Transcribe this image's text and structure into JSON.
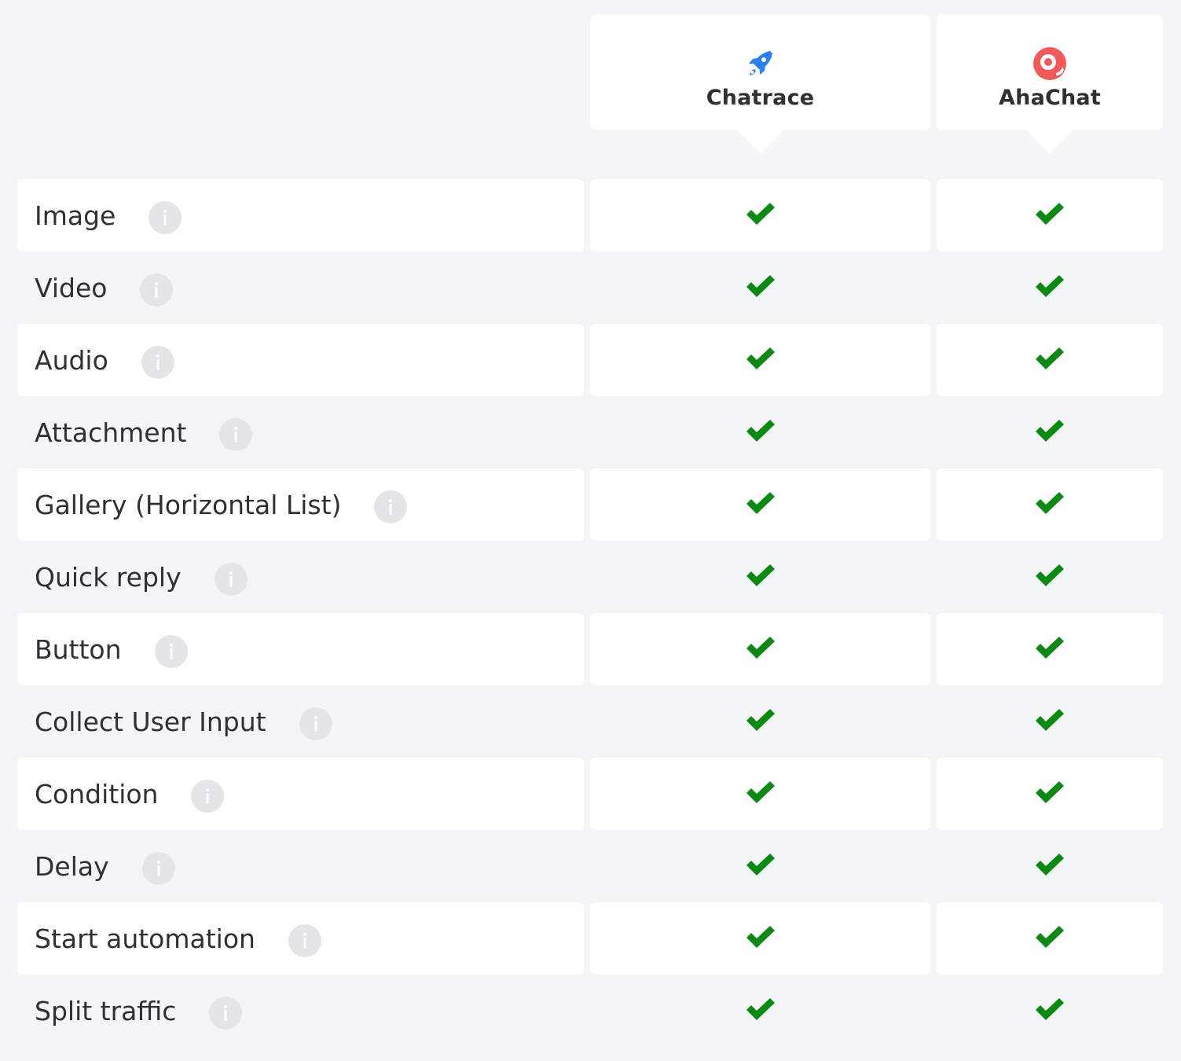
{
  "columns": {
    "chatrace": {
      "name": "Chatrace",
      "logo_icon": "rocket-icon",
      "logo_color": "#2b7ff6"
    },
    "ahachat": {
      "name": "AhaChat",
      "logo_icon": "ahachat-logo-icon",
      "logo_color": "#f25a5a"
    }
  },
  "colors": {
    "background": "#f4f5f7",
    "card": "#ffffff",
    "check": "#0a8a13",
    "info_badge": "#e4e5e7"
  },
  "features": [
    {
      "label": "Image",
      "chatrace": true,
      "ahachat": true
    },
    {
      "label": "Video",
      "chatrace": true,
      "ahachat": true
    },
    {
      "label": "Audio",
      "chatrace": true,
      "ahachat": true
    },
    {
      "label": "Attachment",
      "chatrace": true,
      "ahachat": true
    },
    {
      "label": "Gallery (Horizontal List)",
      "chatrace": true,
      "ahachat": true
    },
    {
      "label": "Quick reply",
      "chatrace": true,
      "ahachat": true
    },
    {
      "label": "Button",
      "chatrace": true,
      "ahachat": true
    },
    {
      "label": "Collect User Input",
      "chatrace": true,
      "ahachat": true
    },
    {
      "label": "Condition",
      "chatrace": true,
      "ahachat": true
    },
    {
      "label": "Delay",
      "chatrace": true,
      "ahachat": true
    },
    {
      "label": "Start automation",
      "chatrace": true,
      "ahachat": true
    },
    {
      "label": "Split traffic",
      "chatrace": true,
      "ahachat": true
    }
  ]
}
